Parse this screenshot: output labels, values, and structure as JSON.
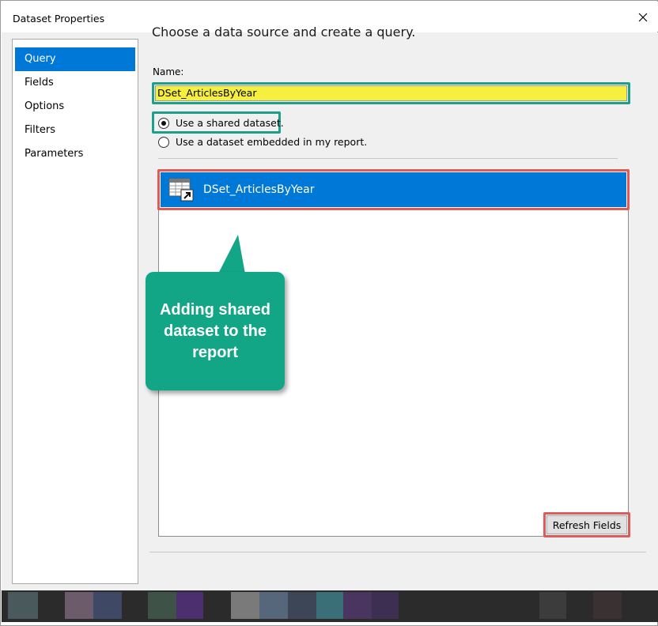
{
  "dialog": {
    "title": "Dataset Properties",
    "close_icon": "close-icon"
  },
  "nav": {
    "items": [
      {
        "label": "Query",
        "selected": true
      },
      {
        "label": "Fields",
        "selected": false
      },
      {
        "label": "Options",
        "selected": false
      },
      {
        "label": "Filters",
        "selected": false
      },
      {
        "label": "Parameters",
        "selected": false
      }
    ]
  },
  "query": {
    "heading": "Choose a data source and create a query.",
    "name_label": "Name:",
    "name_value": "DSet_ArticlesByYear",
    "radio_shared": "Use a shared dataset.",
    "radio_embedded": "Use a dataset embedded in my report.",
    "selected_option": "shared",
    "dataset_list": [
      {
        "label": "DSet_ArticlesByYear",
        "icon": "shared-dataset-icon",
        "selected": true
      }
    ],
    "refresh_button": "Refresh Fields"
  },
  "annotation": {
    "text": "Adding shared dataset to the report"
  },
  "colors": {
    "accent": "#0078d7",
    "name_highlight": "#f7ef3e",
    "teal_outline": "#1f9e8c",
    "red_outline": "#e05a5a",
    "callout": "#13a686"
  }
}
